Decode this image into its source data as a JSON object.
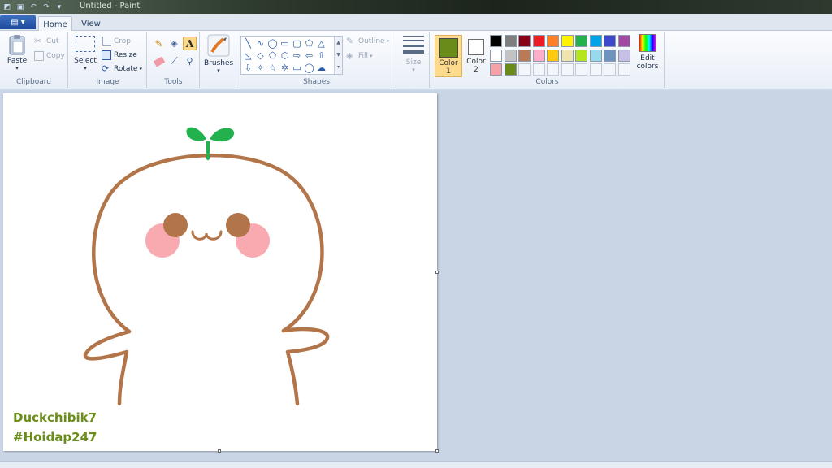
{
  "window": {
    "title": "Untitled - Paint"
  },
  "tabs": {
    "file_icon": "file-menu-icon",
    "home": "Home",
    "view": "View"
  },
  "clipboard": {
    "paste": "Paste",
    "cut": "Cut",
    "copy": "Copy",
    "label": "Clipboard"
  },
  "image": {
    "select": "Select",
    "crop": "Crop",
    "resize": "Resize",
    "rotate": "Rotate",
    "label": "Image"
  },
  "tools": {
    "label": "Tools"
  },
  "brushes": {
    "label": "Brushes"
  },
  "shapes": {
    "outline": "Outline",
    "fill": "Fill",
    "label": "Shapes"
  },
  "size": {
    "label": "Size"
  },
  "colors": {
    "color1_label": "Color",
    "color1_num": "1",
    "color2_label": "Color",
    "color2_num": "2",
    "edit": "Edit",
    "edit2": "colors",
    "label": "Colors",
    "color1_value": "#6a8a1a",
    "color2_value": "#ffffff",
    "row1": [
      "#000000",
      "#7f7f7f",
      "#880015",
      "#ed1c24",
      "#ff7f27",
      "#fff200",
      "#22b14c",
      "#00a2e8",
      "#3f48cc",
      "#a349a4"
    ],
    "row2": [
      "#ffffff",
      "#c3c3c3",
      "#b97a57",
      "#ffaec9",
      "#ffc90e",
      "#efe4b0",
      "#b5e61d",
      "#99d9ea",
      "#7092be",
      "#c8bfe7"
    ],
    "row3": [
      "#f5a3a8",
      "#6a8a1a",
      "",
      "",
      "",
      "",
      "",
      "",
      "",
      ""
    ]
  },
  "canvas": {
    "line1": "Duckchibik7",
    "line2": "#Hoidap247",
    "stroke_color": "#b27549",
    "sprout_color": "#22b14c",
    "cheek_color": "#f8aab0"
  }
}
